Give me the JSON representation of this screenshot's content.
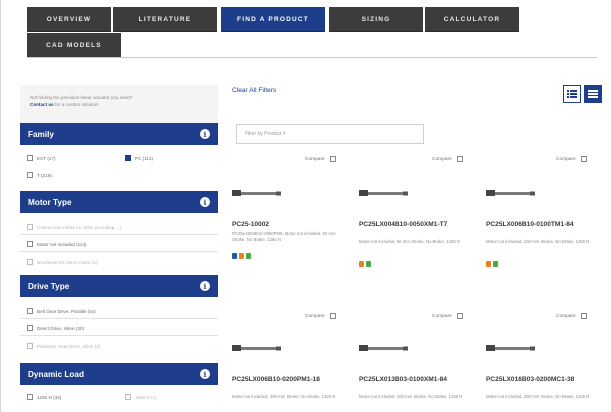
{
  "tabs": [
    {
      "label": "Overview",
      "active": false
    },
    {
      "label": "Literature",
      "active": false
    },
    {
      "label": "Find a Product",
      "active": true
    },
    {
      "label": "Sizing",
      "active": false
    },
    {
      "label": "Calculator",
      "active": false
    },
    {
      "label": "CAD Models",
      "active": false
    }
  ],
  "sidebar": {
    "not_finding_text": "Not finding the precision linear actuator you need?",
    "contact_link": "Contact us",
    "contact_suffix": "for a custom solution!",
    "family": {
      "title": "Family",
      "options": [
        {
          "label": "ECT (27)",
          "checked": false,
          "dim": false
        },
        {
          "label": "PC (114)",
          "checked": true,
          "dim": false
        },
        {
          "label": "T (219)",
          "checked": false,
          "dim": false
        }
      ]
    },
    "motor_type": {
      "title": "Motor Type",
      "options": [
        {
          "label": "Custom low inertia AC MSK (including ...)",
          "dim": true
        },
        {
          "label": "Motor not included (114)",
          "dim": false
        },
        {
          "label": "Brushless DC servo motor (1)",
          "dim": true
        }
      ]
    },
    "drive_type": {
      "title": "Drive Type",
      "options": [
        {
          "label": "Belt Gear Drive, Parallel (54)",
          "dim": false
        },
        {
          "label": "Direct Drive, Inline (30)",
          "dim": false
        },
        {
          "label": "Planetary Gear Drive, Inline (2)",
          "dim": true
        }
      ]
    },
    "dynamic_load": {
      "title": "Dynamic Load",
      "options": [
        {
          "label": "1250 N (33)",
          "dim": false
        },
        {
          "label": "1600 N (1)",
          "dim": true
        }
      ]
    },
    "info_glyph": "i"
  },
  "main": {
    "clear_all": "Clear All Filters",
    "filter_placeholder": "Filter by Product #",
    "compare_label": "Compare",
    "products": [
      {
        "pn": "PC25-10002",
        "desc": "PC25LX004B10-0050FM0, Motor not included, 50 mm Stroke, No Brake, 1250 N",
        "badges": [
          "#1e5aa8",
          "#e8821e",
          "#4aa845"
        ]
      },
      {
        "pn": "PC25LX004B10-0050XM1-T7",
        "desc": "Motor not included, 50 mm Stroke, No Brake, 1250 N",
        "badges": [
          "#e8821e",
          "#4aa845"
        ]
      },
      {
        "pn": "PC25LX006B10-0100TM1-84",
        "desc": "Motor not included, 100 mm Stroke, No Brake, 1250 N",
        "badges": [
          "#e8821e",
          "#4aa845"
        ]
      },
      {
        "pn": "PC25LX006B10-0200PM1-18",
        "desc": "Motor not included, 200 mm Stroke, No Brake, 1250 N",
        "badges": []
      },
      {
        "pn": "PC25LX013B03-0100XM1-84",
        "desc": "Motor not included, 100 mm Stroke, No Brake, 1250 N",
        "badges": []
      },
      {
        "pn": "PC25LX016B03-0200MC1-38",
        "desc": "Motor not included, 200 mm Stroke, No Brake, 1250 N",
        "badges": []
      }
    ]
  },
  "colors": {
    "brand": "#1e3e8b",
    "tab_bg": "#3c3c3c"
  }
}
